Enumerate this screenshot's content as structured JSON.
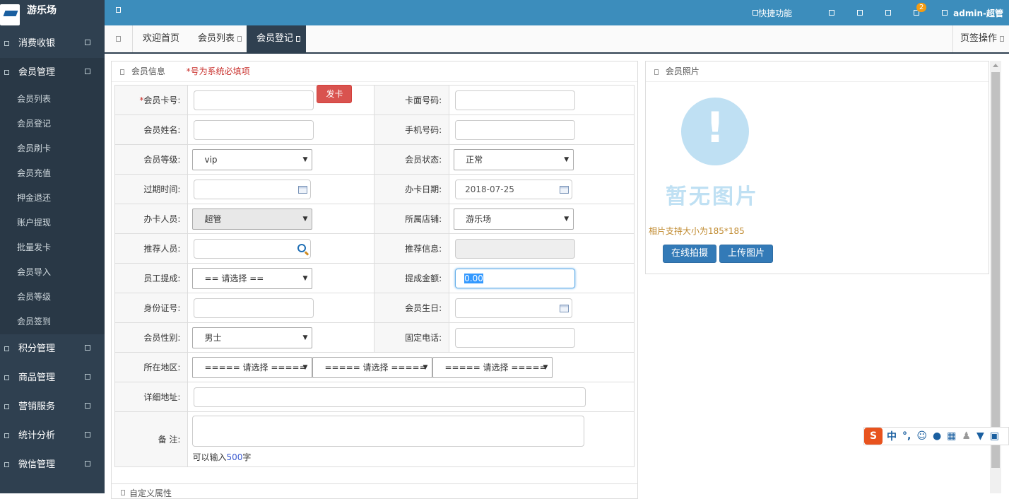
{
  "app": {
    "logo_text": "游乐场"
  },
  "sidebar": {
    "items_top": [
      {
        "label": "消费收银"
      }
    ],
    "active": {
      "label": "会员管理"
    },
    "subitems": [
      {
        "label": "会员列表"
      },
      {
        "label": "会员登记"
      },
      {
        "label": "会员刷卡"
      },
      {
        "label": "会员充值"
      },
      {
        "label": "押金退还"
      },
      {
        "label": "账户提现"
      },
      {
        "label": "批量发卡"
      },
      {
        "label": "会员导入"
      },
      {
        "label": "会员等级"
      },
      {
        "label": "会员签到"
      }
    ],
    "items_bottom": [
      {
        "label": "积分管理"
      },
      {
        "label": "商品管理"
      },
      {
        "label": "营销服务"
      },
      {
        "label": "统计分析"
      },
      {
        "label": "微信管理"
      }
    ]
  },
  "topbar": {
    "quick": "快捷功能",
    "badge": "2",
    "user": "admin-超管"
  },
  "tabs": {
    "items": [
      {
        "label": "欢迎首页"
      },
      {
        "label": "会员列表"
      },
      {
        "label": "会员登记"
      }
    ],
    "right": "页签操作"
  },
  "member_info": {
    "title": "会员信息",
    "required_note": "*号为系统必填项",
    "card_no": {
      "star": "*",
      "label": "会员卡号:",
      "value": ""
    },
    "issue_btn": "发卡",
    "face_no": {
      "label": "卡面号码:",
      "value": ""
    },
    "name": {
      "label": "会员姓名:",
      "value": ""
    },
    "phone": {
      "label": "手机号码:",
      "value": ""
    },
    "level": {
      "label": "会员等级:",
      "value": "vip"
    },
    "status": {
      "label": "会员状态:",
      "value": "正常"
    },
    "expire": {
      "label": "过期时间:",
      "value": ""
    },
    "open_date": {
      "label": "办卡日期:",
      "value": "2018-07-25"
    },
    "staff": {
      "label": "办卡人员:",
      "value": "超管"
    },
    "store": {
      "label": "所属店铺:",
      "value": "游乐场"
    },
    "referrer": {
      "label": "推荐人员:",
      "value": ""
    },
    "ref_info": {
      "label": "推荐信息:",
      "value": ""
    },
    "commission": {
      "label": "员工提成:",
      "value": "== 请选择 =="
    },
    "commission_amt": {
      "label": "提成金额:",
      "value": "0.00"
    },
    "id_card": {
      "label": "身份证号:",
      "value": ""
    },
    "birthday": {
      "label": "会员生日:",
      "value": ""
    },
    "gender": {
      "label": "会员性别:",
      "value": "男士"
    },
    "tel": {
      "label": "固定电话:",
      "value": ""
    },
    "region": {
      "label": "所在地区:",
      "opt1": "===== 请选择 =====",
      "opt2": "===== 请选择 =====",
      "opt3": "===== 请选择 ====="
    },
    "address": {
      "label": "详细地址:",
      "value": ""
    },
    "remark": {
      "label": "备 注:",
      "hint_pre": "可以输入",
      "hint_num": "500",
      "hint_post": "字"
    }
  },
  "photo": {
    "title": "会员照片",
    "noimage": "暂无图片",
    "hint": "相片支持大小为185*185",
    "btn_capture": "在线拍摄",
    "btn_upload": "上传图片"
  },
  "custom": {
    "title": "自定义属性"
  },
  "ime": {
    "lang": "中",
    "punc": "°,"
  },
  "colors": {
    "sidebar": "#2f4050",
    "topbar": "#3c8dbc",
    "danger": "#d9534f",
    "primary": "#337ab7"
  }
}
